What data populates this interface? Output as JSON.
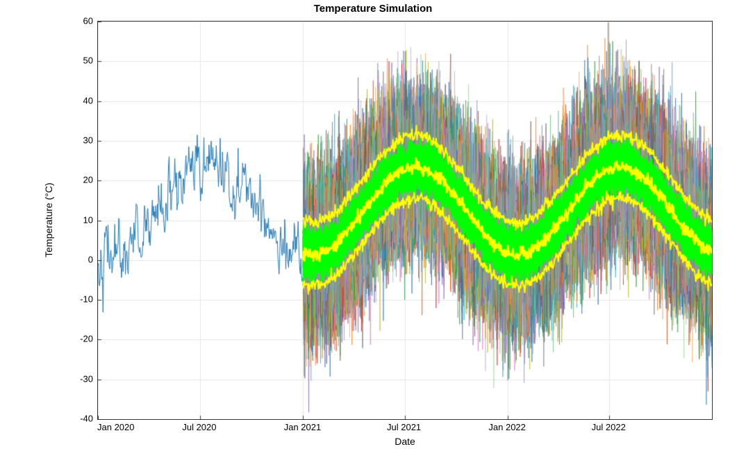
{
  "chart_data": {
    "type": "line",
    "title": "Temperature Simulation",
    "xlabel": "Date",
    "ylabel": "Temperature (°C)",
    "ylim": [
      -40,
      60
    ],
    "y_ticks": [
      -40,
      -30,
      -20,
      -10,
      0,
      10,
      20,
      30,
      40,
      50,
      60
    ],
    "x_tick_labels": [
      "Jan 2020",
      "Jul 2020",
      "Jan 2021",
      "Jul 2021",
      "Jan 2022",
      "Jul 2022"
    ],
    "x_tick_days": [
      0,
      182,
      366,
      547,
      731,
      912
    ],
    "x_range_days": [
      0,
      1095
    ],
    "history": {
      "start_day": 0,
      "end_day": 365,
      "mean_base": 12.5,
      "amplitude": 11,
      "phase_peak_day": 200,
      "noise_sd": 3.5,
      "series_color": "#1f77b4",
      "range_c": [
        0,
        30
      ]
    },
    "simulation": {
      "n_paths": 120,
      "start_day": 366,
      "end_day": 1095,
      "mean_base": 12.5,
      "amplitude": 11,
      "phase_peak_day": 200,
      "noise_sd": 9,
      "band_full_c": [
        -32,
        52
      ],
      "envelope_mid": {
        "color": "#ffff00",
        "width": 2,
        "offset": 0
      },
      "envelope_inner": {
        "color": "#ffff00",
        "width": 2,
        "offset": 8
      },
      "core_band": {
        "color": "#00ff00",
        "offset": 3,
        "noise": 2.0
      },
      "palette": [
        "#1f77b4",
        "#ff7f0e",
        "#d62728",
        "#9467bd",
        "#8c564b",
        "#2ca02c",
        "#17becf",
        "#e377c2",
        "#7f7f7f",
        "#bcbd22",
        "#3182bd",
        "#e6550d",
        "#31a354",
        "#756bb1",
        "#636363",
        "#6baed6",
        "#fd8d3c",
        "#74c476",
        "#9e9ac8",
        "#969696",
        "#9ecae1",
        "#fdae6b",
        "#a1d99b",
        "#bcbddc",
        "#bdbdbd"
      ]
    }
  }
}
